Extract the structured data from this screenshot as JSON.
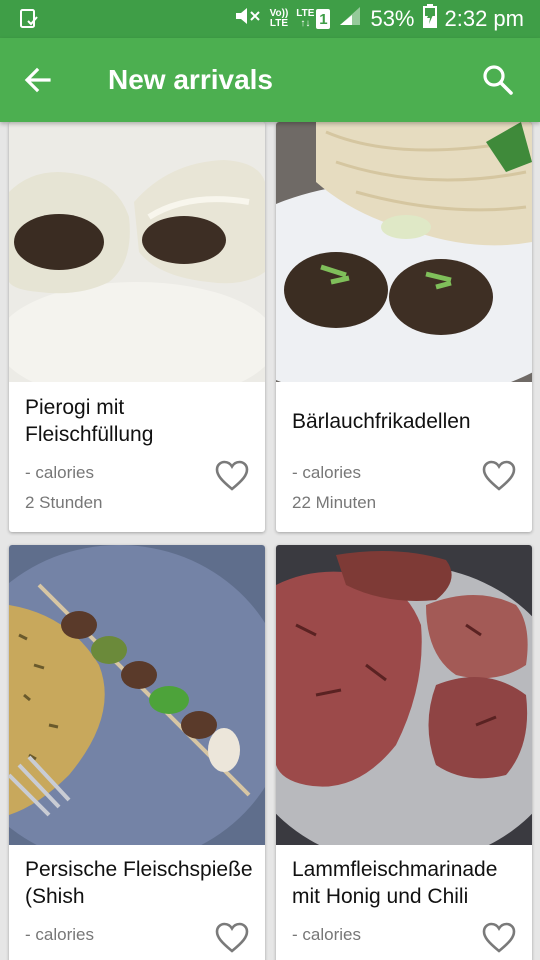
{
  "status_bar": {
    "network_top": "Vo))",
    "network_bottom": "LTE",
    "lte2_top": "LTE",
    "lte2_bottom": "↑↓",
    "sim_slot": "1",
    "battery": "53%",
    "time": "2:32 pm"
  },
  "app_bar": {
    "title": "New arrivals"
  },
  "recipes": [
    {
      "name": "Pierogi mit Fleischfüllung",
      "calories": "- calories",
      "time": "2 Stunden"
    },
    {
      "name": "Bärlauchfrikadellen",
      "calories": "- calories",
      "time": "22 Minuten"
    },
    {
      "name": "Persische Fleischspieße (Shish",
      "calories": "- calories",
      "time": ""
    },
    {
      "name": "Lammfleischmarinade mit Honig und Chili",
      "calories": "- calories",
      "time": ""
    }
  ],
  "colors": {
    "status_bar": "#3f9e47",
    "app_bar": "#4caf50",
    "background": "#e6e6e6"
  }
}
